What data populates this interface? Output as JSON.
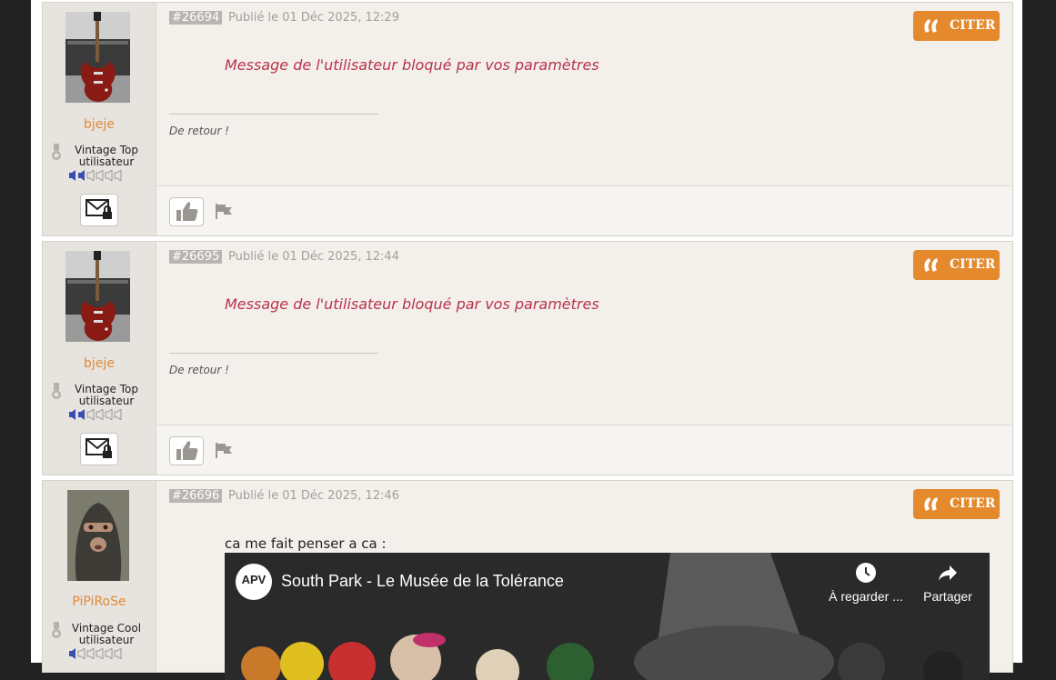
{
  "colors": {
    "accent": "#e48a2d",
    "username": "#e08a3a",
    "blocked_text": "#b8324a",
    "page_bg": "#222222"
  },
  "posts": [
    {
      "number": "#26694",
      "date": "Publié le 01 Déc 2025, 12:29",
      "quote_label": "CITER",
      "user": {
        "name": "bjeje",
        "rank": "Vintage Top utilisateur",
        "rank_level": 2,
        "rank_max": 6
      },
      "blocked_message": "Message de l'utilisateur bloqué par vos paramètres",
      "signature": "De retour !"
    },
    {
      "number": "#26695",
      "date": "Publié le 01 Déc 2025, 12:44",
      "quote_label": "CITER",
      "user": {
        "name": "bjeje",
        "rank": "Vintage Top utilisateur",
        "rank_level": 2,
        "rank_max": 6
      },
      "blocked_message": "Message de l'utilisateur bloqué par vos paramètres",
      "signature": "De retour !"
    },
    {
      "number": "#26696",
      "date": "Publié le 01 Déc 2025, 12:46",
      "quote_label": "CITER",
      "user": {
        "name": "PiPiRoSe",
        "rank": "Vintage Cool utilisateur",
        "rank_level": 1,
        "rank_max": 6
      },
      "text": "ca me fait penser a ca :",
      "video": {
        "title": "South Park - Le Musée de la Tolérance",
        "watch_later": "À regarder ...",
        "share": "Partager",
        "channel_logo": "APV"
      }
    }
  ],
  "icons": {
    "quote": "quote-icon",
    "like": "thumbs-up-icon",
    "report": "flag-icon",
    "message": "locked-envelope-icon",
    "rank": "medal-icon",
    "clock": "clock-icon",
    "share": "share-arrow-icon"
  }
}
